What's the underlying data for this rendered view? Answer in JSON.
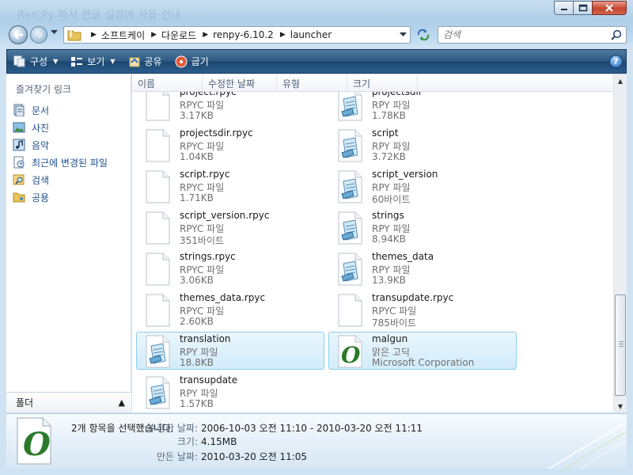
{
  "window": {
    "ghost_title": "Ren'Py 파서 한글 설정에 사용 안내",
    "minimize_icon": "minimize-icon",
    "maximize_icon": "maximize-icon",
    "close_icon": "close-icon"
  },
  "address": {
    "crumbs": [
      "소프트케이",
      "다운로드",
      "renpy-6.10.2",
      "launcher"
    ]
  },
  "search": {
    "placeholder": "검색"
  },
  "toolbar": {
    "organize": "구성",
    "views": "보기",
    "share": "공유",
    "burn": "굽기"
  },
  "nav": {
    "favorites_title": "즐겨찾기 링크",
    "items": [
      "문서",
      "사진",
      "음악",
      "최근에 변경된 파일",
      "검색",
      "공용"
    ],
    "folders_label": "폴더"
  },
  "columns": [
    "이름",
    "수정한 날짜",
    "유형",
    "크기"
  ],
  "files": [
    {
      "name": "project.rpyc",
      "type": "RPYC 파일",
      "size": "3.17KB",
      "kind": "blank"
    },
    {
      "name": "projectsdir",
      "type": "RPY 파일",
      "size": "1.78KB",
      "kind": "rpy"
    },
    {
      "name": "projectsdir.rpyc",
      "type": "RPYC 파일",
      "size": "1.04KB",
      "kind": "blank"
    },
    {
      "name": "script",
      "type": "RPY 파일",
      "size": "3.72KB",
      "kind": "rpy"
    },
    {
      "name": "script.rpyc",
      "type": "RPYC 파일",
      "size": "1.71KB",
      "kind": "blank"
    },
    {
      "name": "script_version",
      "type": "RPY 파일",
      "size": "60바이트",
      "kind": "rpy"
    },
    {
      "name": "script_version.rpyc",
      "type": "RPYC 파일",
      "size": "351바이트",
      "kind": "blank"
    },
    {
      "name": "strings",
      "type": "RPY 파일",
      "size": "8.94KB",
      "kind": "rpy"
    },
    {
      "name": "strings.rpyc",
      "type": "RPYC 파일",
      "size": "3.06KB",
      "kind": "blank"
    },
    {
      "name": "themes_data",
      "type": "RPY 파일",
      "size": "13.9KB",
      "kind": "rpy"
    },
    {
      "name": "themes_data.rpyc",
      "type": "RPYC 파일",
      "size": "2.60KB",
      "kind": "blank"
    },
    {
      "name": "transupdate.rpyc",
      "type": "RPYC 파일",
      "size": "785바이트",
      "kind": "blank"
    },
    {
      "name": "translation",
      "type": "RPY 파일",
      "size": "18.8KB",
      "kind": "rpy",
      "selected": true
    },
    {
      "name": "malgun",
      "type": "맑은 고딕",
      "size": "Microsoft Corporation",
      "kind": "font",
      "selected": true
    },
    {
      "name": "transupdate",
      "type": "RPY 파일",
      "size": "1.57KB",
      "kind": "rpy"
    }
  ],
  "details": {
    "selection": "2개 항목을 선택했습니다.",
    "modified_label": "수정한 날짜:",
    "modified_value": "2006-10-03 오전 11:10 - 2010-03-20 오전 11:11",
    "size_label": "크기:",
    "size_value": "4.15MB",
    "created_label": "만든 날짜:",
    "created_value": "2010-03-20 오전 11:05"
  },
  "scrollbar": {
    "position_fraction": 0.73
  },
  "colors": {
    "accent": "#2e5a82",
    "link": "#1f4f8a",
    "selection": "#d2ecfb"
  }
}
